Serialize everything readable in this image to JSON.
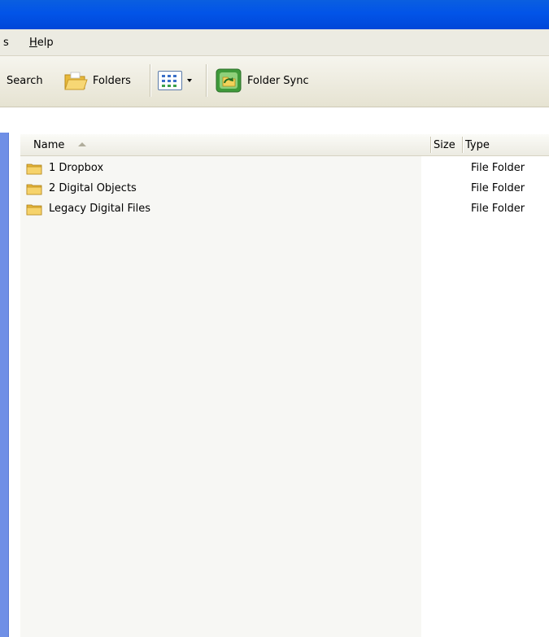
{
  "menu": {
    "clipped_item": "s",
    "help_accel": "H",
    "help_rest": "elp"
  },
  "toolbar": {
    "search_label": "Search",
    "folders_label": "Folders",
    "sync_label": "Folder Sync"
  },
  "columns": {
    "name": "Name",
    "size": "Size",
    "type": "Type"
  },
  "files": [
    {
      "name": "1 Dropbox",
      "size": "",
      "type": "File Folder"
    },
    {
      "name": "2 Digital Objects",
      "size": "",
      "type": "File Folder"
    },
    {
      "name": "Legacy Digital Files",
      "size": "",
      "type": "File Folder"
    }
  ],
  "colors": {
    "titlebar": "#0254e8",
    "left_pane": "#6f8fe6",
    "folder": "#f2c94c"
  },
  "icons": {
    "folders_button": "folder-icon",
    "views_button": "views-icon",
    "sync_button": "folder-sync-icon",
    "file_row": "folder-icon",
    "sort": "sort-ascending-icon"
  }
}
